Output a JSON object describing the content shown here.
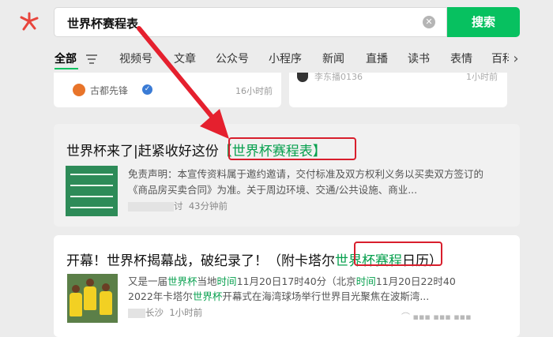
{
  "search": {
    "query": "世界杯赛程表",
    "button_label": "搜索"
  },
  "tabs": [
    {
      "label": "全部",
      "active": true
    },
    {
      "label": "视频号"
    },
    {
      "label": "文章"
    },
    {
      "label": "公众号"
    },
    {
      "label": "小程序"
    },
    {
      "label": "新闻"
    },
    {
      "label": "直播"
    },
    {
      "label": "读书"
    },
    {
      "label": "表情"
    },
    {
      "label": "百科"
    }
  ],
  "top_cards": {
    "left": {
      "account": "古都先锋",
      "time": "16小时前"
    },
    "right": {
      "account": "李东播0136",
      "time": "1小时前"
    }
  },
  "results": [
    {
      "title_prefix": "世界杯来了|赶紧收好这份",
      "title_highlight": "【世界杯赛程表】",
      "description": "免责声明：本宣传资料属于邀约邀请，交付标准及双方权利义务以买卖双方签订的《商品房买卖合同》为准。关于周边环境、交通/公共设施、商业...",
      "meta_suffix": "讨",
      "time": "43分钟前"
    },
    {
      "title_prefix": "开幕！世界杯揭幕战，破纪录了！（附卡塔尔",
      "title_highlight": "世界杯赛程",
      "title_suffix": "日历）",
      "desc_line1": {
        "p1": "又是一届",
        "h1": "世界杯",
        "p2": "当地",
        "h2": "时间",
        "p3": "11月20日17时40分（北京",
        "h3": "时间",
        "p4": "11月20日22时40"
      },
      "desc_line2": {
        "p1": "2022年卡塔尔",
        "h1": "世界杯",
        "p2": "开幕式在海湾球场举行世界目光聚焦在波斯湾..."
      },
      "meta_suffix": "长沙",
      "time": "1小时前"
    }
  ],
  "colors": {
    "accent_green": "#07c160",
    "highlight_red": "#d81e2c",
    "annotation_arrow": "#e5202e"
  }
}
